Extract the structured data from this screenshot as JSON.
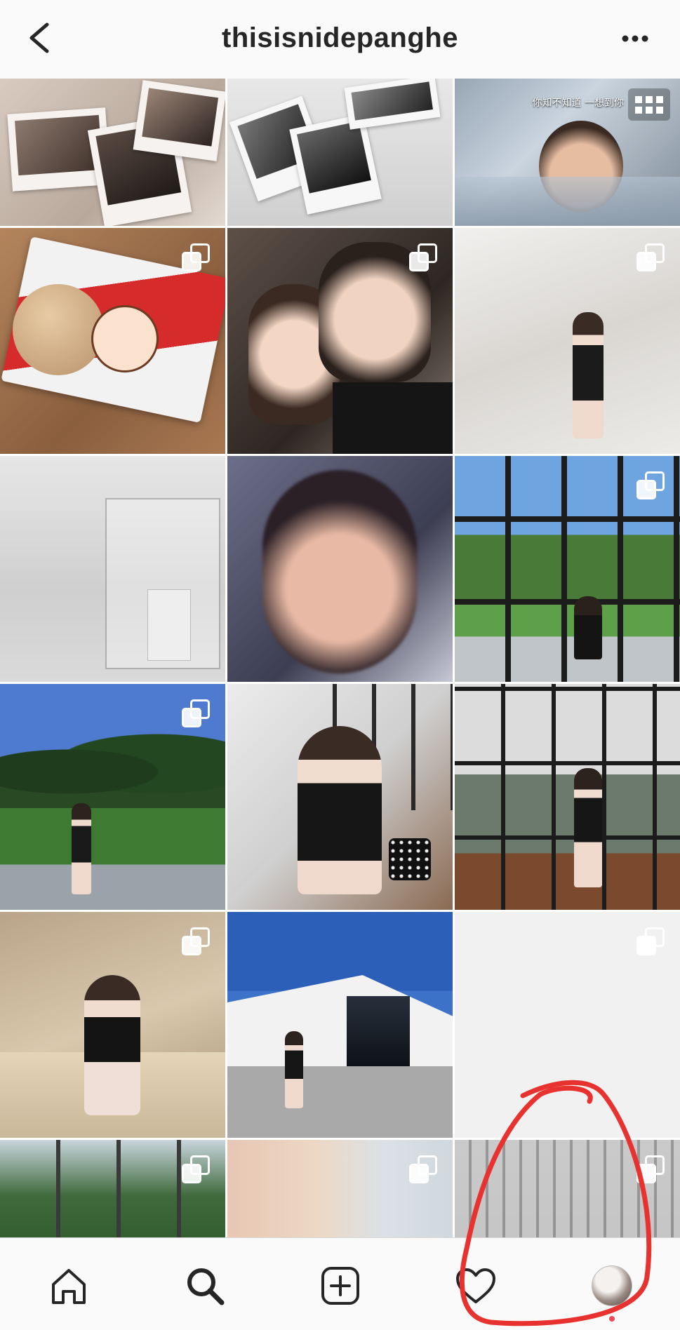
{
  "header": {
    "title": "thisisnidepanghe",
    "back_icon": "back-arrow-icon",
    "more_icon": "more-options-icon"
  },
  "grid": {
    "columns": 3,
    "tiles": [
      {
        "id": "r1c1",
        "subject": "instant photos on bed",
        "multi": false
      },
      {
        "id": "r1c2",
        "subject": "instant photos on sheet",
        "multi": false
      },
      {
        "id": "r1c3",
        "subject": "sleeping child",
        "multi": false,
        "grid_badge": true,
        "overlay_text": "你知不知道 一想到你"
      },
      {
        "id": "r2c1",
        "subject": "milky puff packet",
        "multi": true
      },
      {
        "id": "r2c2",
        "subject": "couple selfie",
        "multi": true
      },
      {
        "id": "r2c3",
        "subject": "woman in white gallery",
        "multi": true
      },
      {
        "id": "r3c1",
        "subject": "glass display case",
        "multi": false
      },
      {
        "id": "r3c2",
        "subject": "blurry selfie",
        "multi": false
      },
      {
        "id": "r3c3",
        "subject": "window with trees",
        "multi": true
      },
      {
        "id": "r4c1",
        "subject": "woman on lawn",
        "multi": true
      },
      {
        "id": "r4c2",
        "subject": "woman seated indoors",
        "multi": false
      },
      {
        "id": "r4c3",
        "subject": "woman by glass wall",
        "multi": false
      },
      {
        "id": "r5c1",
        "subject": "woman on steps",
        "multi": true
      },
      {
        "id": "r5c2",
        "subject": "white building",
        "multi": false
      },
      {
        "id": "r5c3",
        "subject": "blank white",
        "multi": true
      },
      {
        "id": "r6c1",
        "subject": "trees through window",
        "multi": true
      },
      {
        "id": "r6c2",
        "subject": "pastel wall",
        "multi": true
      },
      {
        "id": "r6c3",
        "subject": "apartment buildings",
        "multi": true
      }
    ]
  },
  "bottom_nav": {
    "items": [
      {
        "name": "home",
        "icon": "home-icon"
      },
      {
        "name": "search",
        "icon": "search-icon",
        "active": true
      },
      {
        "name": "add-post",
        "icon": "add-post-icon"
      },
      {
        "name": "activity",
        "icon": "heart-icon"
      },
      {
        "name": "profile",
        "icon": "profile-avatar"
      }
    ]
  },
  "colors": {
    "header_bg": "#fafafa",
    "text": "#262626",
    "nav_bg": "#fafafa",
    "annotation": "#e8322f",
    "notification": "#ed4956"
  }
}
